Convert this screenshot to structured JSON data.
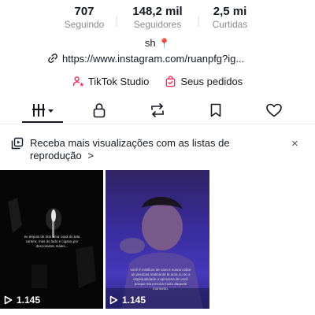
{
  "stats": [
    {
      "value": "707",
      "label": "Seguindo"
    },
    {
      "value": "148,2 mil",
      "label": "Seguidores"
    },
    {
      "value": "2,5 mi",
      "label": "Curtidas"
    }
  ],
  "bio": {
    "text": "sh",
    "emoji": "📍"
  },
  "link": {
    "url": "https://www.instagram.com/ruanpfg?ig..."
  },
  "actions": {
    "studio_label": "TikTok Studio",
    "orders_label": "Seus pedidos"
  },
  "tabs": [
    {
      "name": "videos-grid",
      "icon": "grid-icon",
      "active": true
    },
    {
      "name": "private",
      "icon": "lock-icon"
    },
    {
      "name": "reposts",
      "icon": "repost-icon"
    },
    {
      "name": "favorites",
      "icon": "bookmark-icon"
    },
    {
      "name": "liked",
      "icon": "heart-icon"
    }
  ],
  "banner": {
    "text": "Receba mais visualizações com as listas de reprodução",
    "arrow": ">",
    "close": "×"
  },
  "videos": [
    {
      "views": "1.145",
      "caption": "eu depois de tirar uma copa do tata careira, mas do lado e cigana por desconvites males..."
    },
    {
      "views": "1.145",
      "caption": "você é mistilum de cara e nunca cobre as pessoas realmente te ama ou se a espiritualidade a aproxima de você porque ela precisa muito daquele momento."
    }
  ],
  "colors": {
    "accent": "#fe2c55",
    "text": "#161823",
    "muted": "#8a8b91"
  }
}
